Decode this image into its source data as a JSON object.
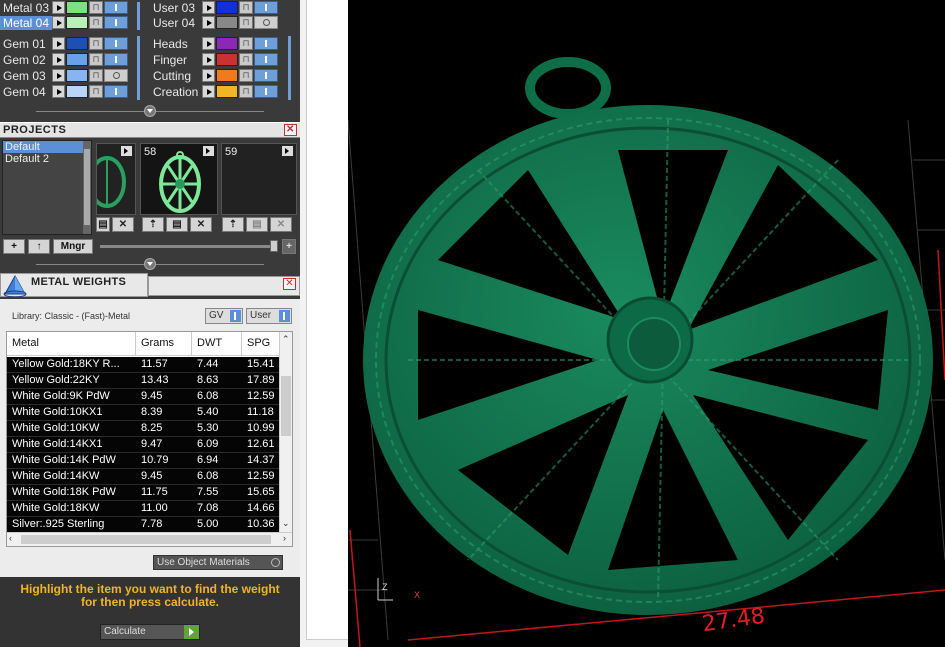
{
  "layers": {
    "left": [
      {
        "name": "Metal 03",
        "color": "#7ee07e",
        "selected": false
      },
      {
        "name": "Metal 04",
        "color": "#b8f0b8",
        "selected": true
      },
      {
        "name": "Gem 01",
        "color": "#1e50b4",
        "selected": false
      },
      {
        "name": "Gem 02",
        "color": "#6aa0e8",
        "selected": false
      },
      {
        "name": "Gem 03",
        "color": "#8ab4f0",
        "selected": false
      },
      {
        "name": "Gem 04",
        "color": "#b8d4f8",
        "selected": false
      }
    ],
    "right": [
      {
        "name": "User 03",
        "color": "#1030e0"
      },
      {
        "name": "User 04",
        "color": "#888888"
      },
      {
        "name": "Heads",
        "color": "#8a2ab4"
      },
      {
        "name": "Finger",
        "color": "#c83232"
      },
      {
        "name": "Cutting",
        "color": "#f07a1e"
      },
      {
        "name": "Creation",
        "color": "#f0b428"
      }
    ]
  },
  "projects": {
    "title": "PROJECTS",
    "close": "✕",
    "list": [
      "Default",
      "Default 2"
    ],
    "thumbs": [
      {
        "number": "58"
      },
      {
        "number": "59"
      }
    ],
    "buttons": {
      "add": "+",
      "up": "↑",
      "manager": "Mngr",
      "plus": "+"
    }
  },
  "metal_weights": {
    "title": "METAL WEIGHTS",
    "close": "✕",
    "library": "Library: Classic - (Fast)-Metal",
    "toggle_gv": "GV",
    "toggle_user": "User",
    "columns": [
      "Metal",
      "Grams",
      "DWT",
      "SPG"
    ],
    "rows": [
      [
        "Yellow Gold:18KY R...",
        "11.57",
        "7.44",
        "15.41"
      ],
      [
        "Yellow Gold:22KY",
        "13.43",
        "8.63",
        "17.89"
      ],
      [
        "White Gold:9K PdW",
        "9.45",
        "6.08",
        "12.59"
      ],
      [
        "White Gold:10KX1",
        "8.39",
        "5.40",
        "11.18"
      ],
      [
        "White Gold:10KW",
        "8.25",
        "5.30",
        "10.99"
      ],
      [
        "White Gold:14KX1",
        "9.47",
        "6.09",
        "12.61"
      ],
      [
        "White Gold:14K PdW",
        "10.79",
        "6.94",
        "14.37"
      ],
      [
        "White Gold:14KW",
        "9.45",
        "6.08",
        "12.59"
      ],
      [
        "White Gold:18K PdW",
        "11.75",
        "7.55",
        "15.65"
      ],
      [
        "White Gold:18KW",
        "11.00",
        "7.08",
        "14.66"
      ],
      [
        "Silver:.925 Sterling",
        "7.78",
        "5.00",
        "10.36"
      ]
    ],
    "use_object": "Use Object Materials",
    "hint": "Highlight the item you want to find the weight for then press calculate.",
    "calculate": "Calculate"
  },
  "viewport": {
    "dimension": "27.48",
    "axis_z": "Z",
    "axis_x": "X",
    "model_color": "#0f6e4a"
  }
}
